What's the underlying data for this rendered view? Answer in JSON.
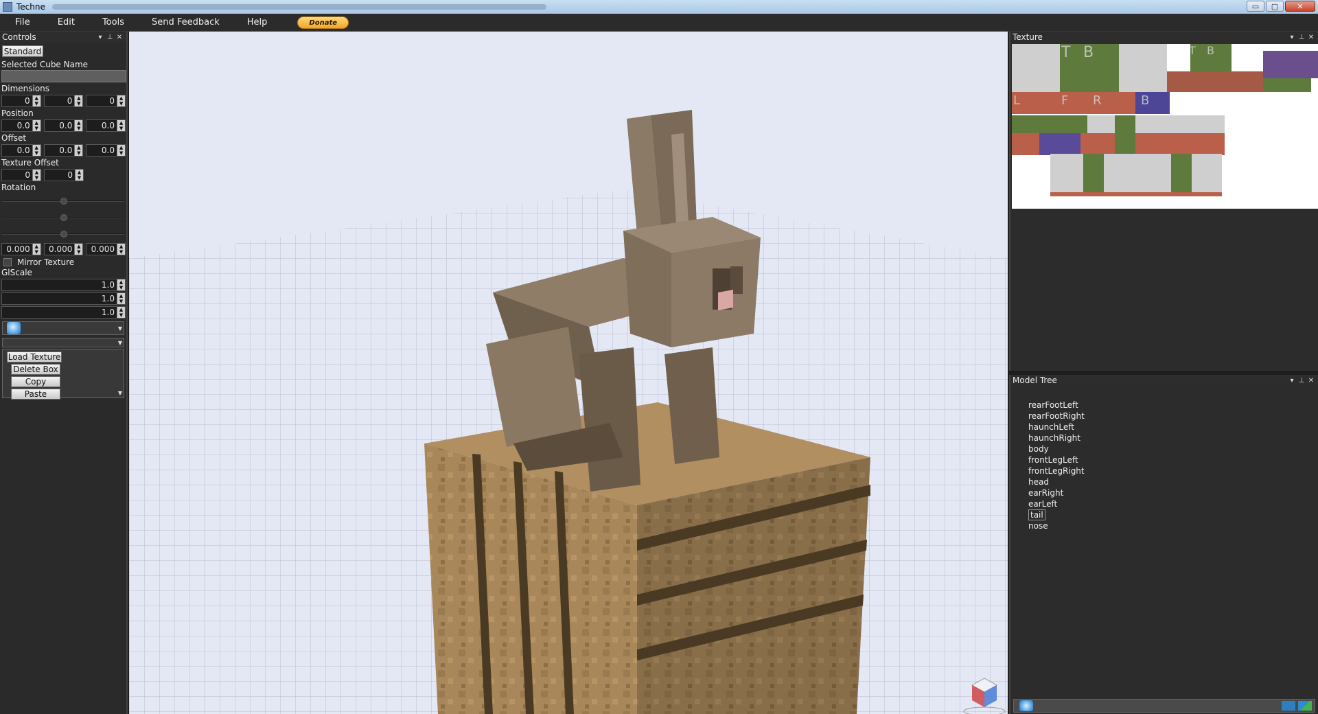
{
  "window": {
    "title": "Techne",
    "min_label": "▭",
    "max_label": "▢",
    "close_label": "✕"
  },
  "menu": {
    "file": "File",
    "edit": "Edit",
    "tools": "Tools",
    "feedback": "Send Feedback",
    "help": "Help",
    "donate": "Donate"
  },
  "controls": {
    "header": "Controls",
    "standard_btn": "Standard",
    "selected_cube_label": "Selected Cube Name",
    "selected_cube_value": "",
    "dimensions_label": "Dimensions",
    "dimensions": [
      "0",
      "0",
      "0"
    ],
    "position_label": "Position",
    "position": [
      "0.0",
      "0.0",
      "0.0"
    ],
    "offset_label": "Offset",
    "offset": [
      "0.0",
      "0.0",
      "0.0"
    ],
    "texture_offset_label": "Texture Offset",
    "texture_offset": [
      "0",
      "0"
    ],
    "rotation_label": "Rotation",
    "rotation": [
      "0.000",
      "0.000",
      "0.000"
    ],
    "mirror_label": "Mirror Texture",
    "mirror_checked": false,
    "glscale_label": "GlScale",
    "glscale": [
      "1.0",
      "1.0",
      "1.0"
    ],
    "actions": {
      "load_texture": "Load Texture",
      "delete_box": "Delete Box",
      "copy": "Copy",
      "paste": "Paste"
    }
  },
  "texture_panel": {
    "header": "Texture",
    "letters": [
      "T",
      "B",
      "T",
      "B",
      "L",
      "F",
      "R",
      "B"
    ]
  },
  "model_tree": {
    "header": "Model Tree",
    "items": [
      "rearFootLeft",
      "rearFootRight",
      "haunchLeft",
      "haunchRight",
      "body",
      "frontLegLeft",
      "frontLegRight",
      "head",
      "earRight",
      "earLeft",
      "tail",
      "nose"
    ],
    "selected": "tail"
  },
  "icons": {
    "panel_dropdown": "dropdown-arrow-icon",
    "panel_pin": "pin-icon",
    "panel_close": "close-icon"
  },
  "colors": {
    "viewport_bg": "#dde3f3",
    "panel_bg": "#2c2c2c",
    "donate_accent": "#f2a52a"
  }
}
